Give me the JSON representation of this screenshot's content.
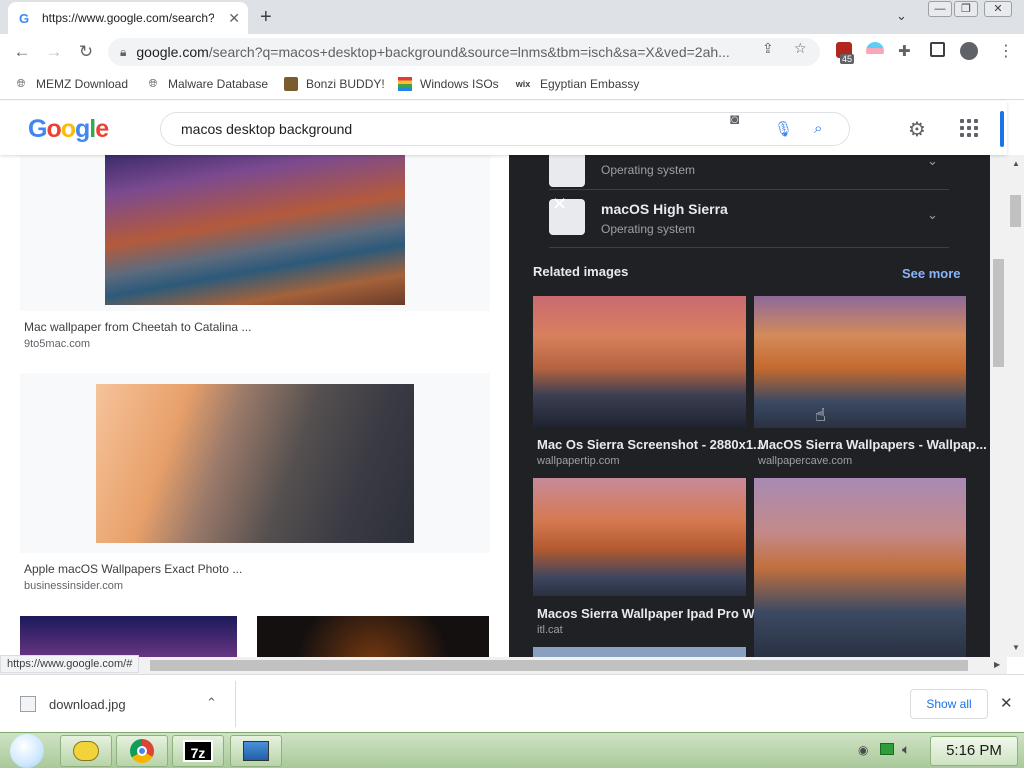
{
  "browser": {
    "tab_title": "https://www.google.com/search?",
    "tab_favicon": "G",
    "url_host": "google.com",
    "url_path": "/search?q=macos+desktop+background&source=lnms&tbm=isch&sa=X&ved=2ah...",
    "extension_badge": "45"
  },
  "bookmarks": [
    {
      "label": "MEMZ Download",
      "icon": "globe-icon"
    },
    {
      "label": "Malware Database",
      "icon": "globe-icon"
    },
    {
      "label": "Bonzi BUDDY!",
      "icon": "bonzi-icon"
    },
    {
      "label": "Windows ISOs",
      "icon": "windows-flag-icon"
    },
    {
      "label": "Egyptian Embassy",
      "icon": "wix-icon"
    }
  ],
  "google": {
    "search_query": "macos desktop background"
  },
  "results": [
    {
      "title": "Mac wallpaper from Cheetah to Catalina ...",
      "source": "9to5mac.com"
    },
    {
      "title": "Apple macOS Wallpapers Exact Photo ...",
      "source": "businessinsider.com"
    }
  ],
  "panel": {
    "os_items": [
      {
        "name": "",
        "type": "Operating system"
      },
      {
        "name": "macOS High Sierra",
        "type": "Operating system"
      }
    ],
    "related_label": "Related images",
    "see_more": "See more",
    "related": [
      {
        "title": "Mac Os Sierra Screenshot - 2880x1...",
        "source": "wallpapertip.com"
      },
      {
        "title": "MacOS Sierra Wallpapers - Wallpap...",
        "source": "wallpapercave.com"
      },
      {
        "title": "Macos Sierra Wallpaper Ipad Pro W...",
        "source": "itl.cat"
      }
    ]
  },
  "status_url": "https://www.google.com/#",
  "download": {
    "filename": "download.jpg",
    "show_all": "Show all"
  },
  "taskbar": {
    "clock": "5:16 PM",
    "sevenzip_label": "7z"
  },
  "colors": {
    "accent": "#1a73e8",
    "panel_bg": "#202124",
    "taskbar": "#b8d4a9"
  }
}
